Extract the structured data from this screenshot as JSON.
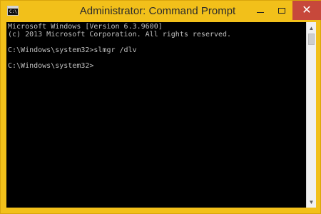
{
  "window": {
    "title": "Administrator: Command Prompt",
    "icon": "cmd-icon",
    "icon_text": "C:\\",
    "controls": {
      "minimize_icon": "minimize-icon",
      "maximize_icon": "maximize-icon",
      "close_label": "✕"
    },
    "accent": "#f2c01a"
  },
  "console": {
    "lines": [
      "Microsoft Windows [Version 6.3.9600]",
      "(c) 2013 Microsoft Corporation. All rights reserved.",
      "C:\\Windows\\system32>slmgr /dlv",
      "C:\\Windows\\system32>"
    ],
    "background": "#000000",
    "text_color": "#c0c0c0"
  },
  "scrollbar": {
    "up_arrow": "▲",
    "down_arrow": "▼"
  }
}
